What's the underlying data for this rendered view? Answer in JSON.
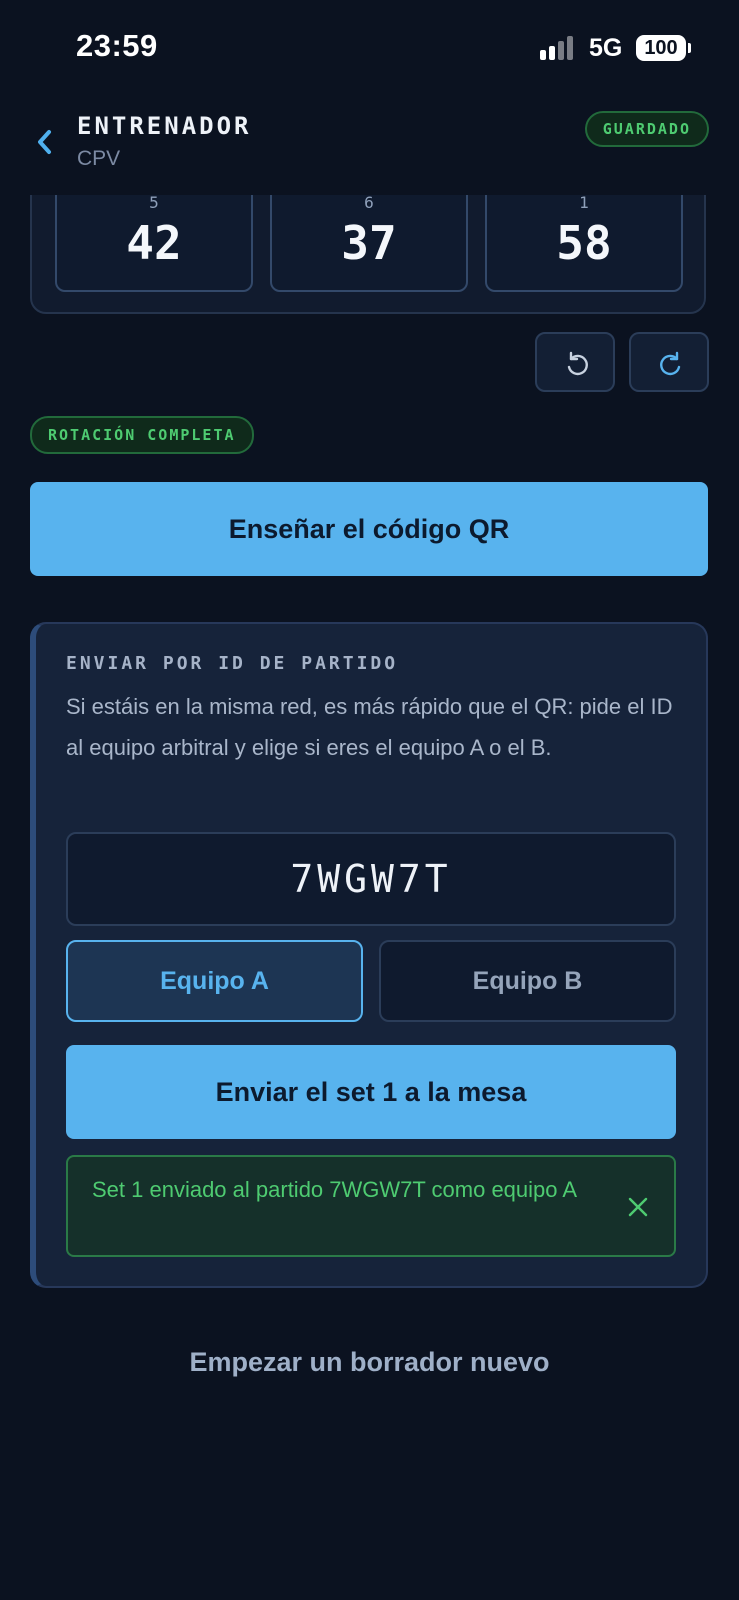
{
  "status_bar": {
    "time": "23:59",
    "network": "5G",
    "battery": "100"
  },
  "header": {
    "title": "ENTRENADOR",
    "subtitle": "CPV",
    "badge": "GUARDADO"
  },
  "lineup": [
    {
      "position": "5",
      "number": "42"
    },
    {
      "position": "6",
      "number": "37"
    },
    {
      "position": "1",
      "number": "58"
    }
  ],
  "rotation_status": "ROTACIÓN COMPLETA",
  "qr_button": "Enseñar el código QR",
  "send_card": {
    "label": "ENVIAR POR ID DE PARTIDO",
    "description": "Si estáis en la misma red, es más rápido que el QR: pide el ID al equipo arbitral y elige si eres el equipo A o el B.",
    "match_id": "7WGW7T",
    "team_a": "Equipo A",
    "team_b": "Equipo B",
    "selected_team": "Equipo A",
    "send_button": "Enviar el set 1 a la mesa",
    "success_message": "Set 1 enviado al partido 7WGW7T como equipo A"
  },
  "new_draft": "Empezar un borrador nuevo",
  "colors": {
    "background": "#0b1220",
    "accent": "#58b3ee",
    "success": "#4ecb71"
  },
  "icons": [
    "chevron-left-icon",
    "rotate-left-icon",
    "rotate-right-icon",
    "close-icon"
  ]
}
